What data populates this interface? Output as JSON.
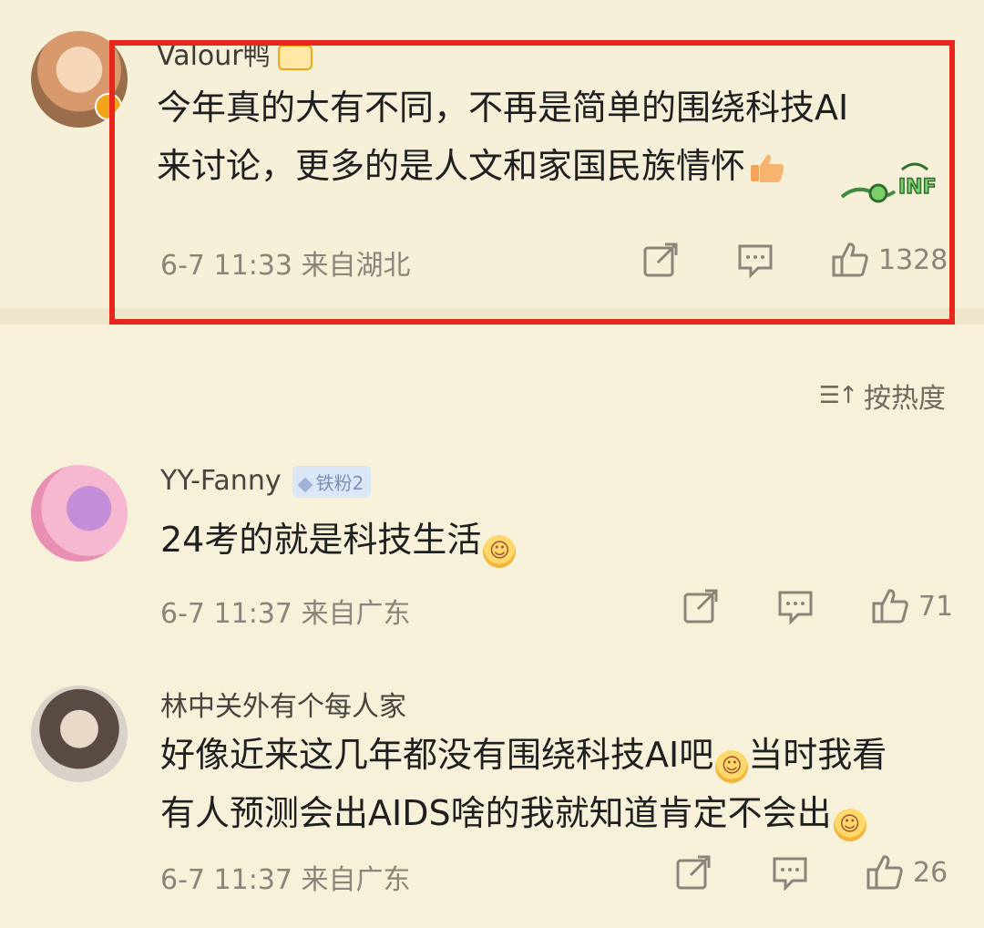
{
  "top_comment": {
    "username": "Valour鸭",
    "text_line1": "今年真的大有不同，不再是简单的围绕科技AI",
    "text_line2": "来讨论，更多的是人文和家国民族情怀",
    "time": "6-7 11:33",
    "location": "来自湖北",
    "likes": "1328"
  },
  "sort": {
    "label": "按热度",
    "icon": "sort-icon"
  },
  "comments": [
    {
      "username": "YY-Fanny",
      "badge": "铁粉2",
      "text": "24考的就是科技生活",
      "time": "6-7 11:37",
      "location": "来自广东",
      "likes": "71"
    },
    {
      "username": "林中关外有个每人家",
      "text_line1": "好像近来这几年都没有围绕科技AI吧",
      "text_line1b": "当时我看",
      "text_line2": "有人预测会出AIDS啥的我就知道肯定不会出",
      "time": "6-7 11:37",
      "location": "来自广东",
      "likes": "26"
    }
  ],
  "colors": {
    "background": "#f7f1da",
    "highlight": "#e8261d",
    "meta": "#8b8579"
  }
}
